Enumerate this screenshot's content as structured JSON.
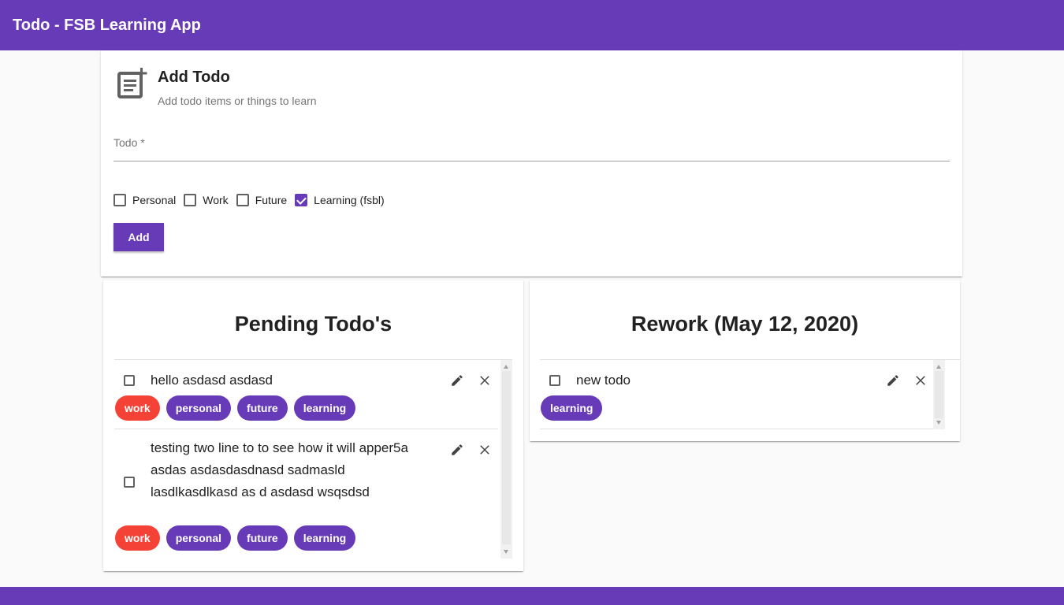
{
  "app": {
    "title": "Todo - FSB Learning App"
  },
  "add_todo": {
    "title": "Add Todo",
    "subtitle": "Add todo items or things to learn",
    "field_label": "Todo *",
    "field_value": "",
    "categories": [
      {
        "label": "Personal",
        "checked": false
      },
      {
        "label": "Work",
        "checked": false
      },
      {
        "label": "Future",
        "checked": false
      },
      {
        "label": "Learning (fsbl)",
        "checked": true
      }
    ],
    "add_label": "Add"
  },
  "pending": {
    "title": "Pending Todo's",
    "items": [
      {
        "text": "hello asdasd asdasd",
        "checked": false,
        "tags": [
          "work",
          "personal",
          "future",
          "learning"
        ]
      },
      {
        "text": "testing two line to to see how it will apper5a asdas asdasdasdnasd sadmasld lasdlkasdlkasd as d asdasd wsqsdsd",
        "checked": false,
        "tags": [
          "work",
          "personal",
          "future",
          "learning"
        ]
      }
    ]
  },
  "rework": {
    "title": "Rework (May 12, 2020)",
    "items": [
      {
        "text": "new todo",
        "checked": false,
        "tags": [
          "learning"
        ]
      }
    ]
  },
  "colors": {
    "primary": "#673ab7",
    "work_chip": "#f44336",
    "background": "#fafafa"
  },
  "icons": {
    "add_todo": "note-add-icon",
    "edit": "pencil-icon",
    "delete": "close-icon"
  }
}
